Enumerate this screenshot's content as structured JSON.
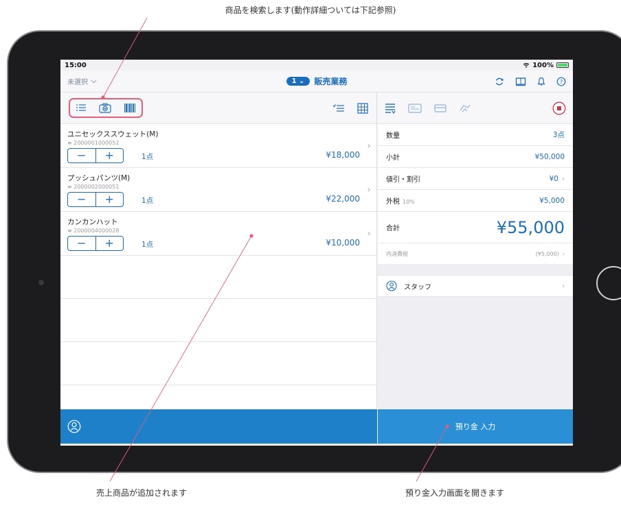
{
  "annotations": {
    "search_note": "商品を検索します(動作詳細ついては下記参照)",
    "added_note": "売上商品が追加されます",
    "deposit_note": "預り金入力画面を開きます"
  },
  "status_bar": {
    "time": "15:00",
    "battery": "100%"
  },
  "nav": {
    "unselected_label": "未選択",
    "mode_badge": "1",
    "mode_title": "販売業務"
  },
  "products": [
    {
      "name": "ユニセックススウェット(M)",
      "code": "2000001000052",
      "qty": "1点",
      "price": "¥18,000"
    },
    {
      "name": "プッシュパンツ(M)",
      "code": "2000002000051",
      "qty": "1点",
      "price": "¥22,000"
    },
    {
      "name": "カンカンハット",
      "code": "2000004000028",
      "qty": "1点",
      "price": "¥10,000"
    }
  ],
  "stepper": {
    "minus": "−",
    "plus": "+"
  },
  "summary": {
    "quantity_label": "数量",
    "quantity_value": "3点",
    "subtotal_label": "小計",
    "subtotal_value": "¥50,000",
    "discount_label": "値引・割引",
    "discount_value": "¥0",
    "tax_label": "外税",
    "tax_rate": "10%",
    "tax_value": "¥5,000",
    "total_label": "合計",
    "total_value": "¥55,000",
    "internal_tax_label": "内消費税",
    "internal_tax_value": "(¥5,000)"
  },
  "staff": {
    "label": "スタッフ"
  },
  "deposit": {
    "label": "預り金 入力"
  },
  "colors": {
    "accent": "#1d6dbd",
    "footer_blue": "#1d80c8",
    "highlight": "#e0607a",
    "record": "#d0314a"
  }
}
